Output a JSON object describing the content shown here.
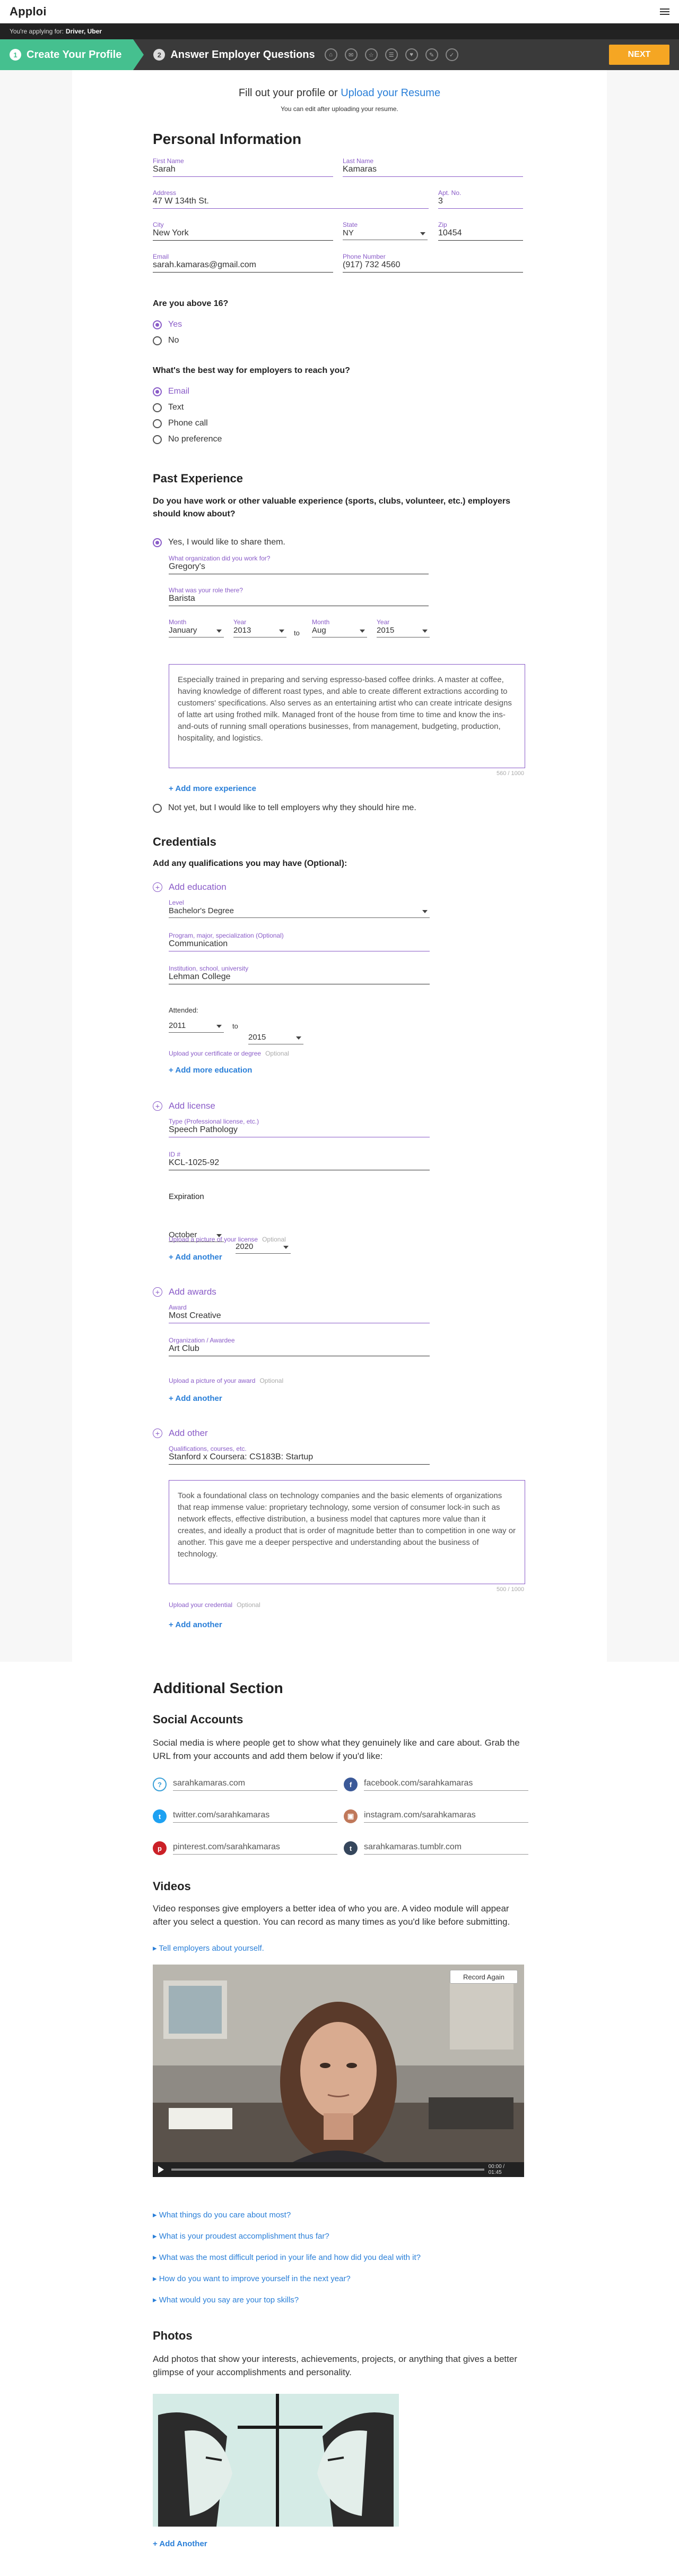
{
  "app": {
    "logo": "Apploi",
    "applying_prefix": "You're applying for:",
    "job": "Driver, Uber"
  },
  "steps": {
    "step1_num": "1",
    "step1": "Create Your Profile",
    "step2_num": "2",
    "step2": "Answer Employer Questions",
    "next": "NEXT",
    "step_icons": [
      "⌂",
      "✉",
      "☆",
      "☰",
      "♥",
      "✎",
      "✓"
    ]
  },
  "intro": {
    "prefix": "Fill out your profile or",
    "link": "Upload your Resume",
    "note": "You can edit after uploading your resume."
  },
  "personal": {
    "title": "Personal Information",
    "first_label": "First Name",
    "first": "Sarah",
    "last_label": "Last Name",
    "last": "Kamaras",
    "address_label": "Address",
    "address": "47 W 134th St.",
    "apt_label": "Apt. No.",
    "apt": "3",
    "city_label": "City",
    "city": "New York",
    "state_label": "State",
    "state": "NY",
    "zip_label": "Zip",
    "zip": "10454",
    "email_label": "Email",
    "email": "sarah.kamaras@gmail.com",
    "phone_label": "Phone Number",
    "phone": "(917) 732 4560",
    "age_q": "Are you above 16?",
    "age_yes": "Yes",
    "age_no": "No",
    "reach_q": "What's the best way for employers to reach you?",
    "reach_opts": [
      "Email",
      "Text",
      "Phone call",
      "No preference"
    ]
  },
  "past": {
    "title": "Past Experience",
    "q": "Do you have work or other valuable experience (sports, clubs, volunteer, etc.) employers should know about?",
    "yes": "Yes, I would like to share them.",
    "org_label": "What organization did you work for?",
    "org": "Gregory's",
    "role_label": "What was your role there?",
    "role": "Barista",
    "month_label": "Month",
    "year_label": "Year",
    "start_month": "January",
    "start_year": "2013",
    "to": "to",
    "end_month": "Aug",
    "end_year": "2015",
    "desc": "Especially trained in preparing and serving espresso-based coffee drinks. A master at coffee, having knowledge of different roast types, and able to create different extractions according to customers' specifications. Also serves as an entertaining artist who can create intricate designs of latte art using frothed milk. Managed front of the house from time to time and know the ins-and-outs of running small operations businesses, from management, budgeting, production, hospitality, and logistics.",
    "counter": "560 / 1000",
    "add_more": "+ Add more experience",
    "not_yet": "Not yet, but I would like to tell employers why they should hire me."
  },
  "credentials": {
    "title": "Credentials",
    "q": "Add any qualifications you may have (Optional):",
    "edu_add": "Add education",
    "level_label": "Level",
    "level": "Bachelor's Degree",
    "program_label": "Program, major, specialization (Optional)",
    "program": "Communication",
    "inst_label": "Institution, school, university",
    "inst": "Lehman College",
    "attended": "Attended:",
    "att_from": "2011",
    "att_to": "to",
    "att_end": "2015",
    "edu_upload": "Upload your certificate or degree",
    "optional": "Optional",
    "edu_more": "+ Add more education",
    "lic_add": "Add license",
    "lic_type_label": "Type (Professional license, etc.)",
    "lic_type": "Speech Pathology",
    "lic_id_label": "ID #",
    "lic_id": "KCL-1025-92",
    "expiration": "Expiration",
    "exp_month": "October",
    "exp_year": "2020",
    "lic_upload": "Upload a picture of your license",
    "lic_more": "+ Add another",
    "award_add": "Add awards",
    "award_label": "Award",
    "award": "Most Creative",
    "awarder_label": "Organization / Awardee",
    "awarder": "Art Club",
    "award_upload": "Upload a picture of your award",
    "award_more": "+ Add another",
    "other_add": "Add other",
    "other_label": "Qualifications, courses, etc.",
    "other": "Stanford x Coursera: CS183B: Startup",
    "other_desc": "Took a foundational class on technology companies and the basic elements of organizations that reap immense value: proprietary technology, some version of consumer lock-in such as network effects, effective distribution, a business model that captures more value than it creates, and ideally a product that is order of magnitude better than to competition in one way or another. This gave me a deeper perspective and understanding about the business of technology.",
    "other_counter": "500 / 1000",
    "other_upload": "Upload your credential",
    "other_more": "+ Add another"
  },
  "additional": {
    "title": "Additional Section",
    "social_title": "Social Accounts",
    "social_desc": "Social media is where people get to show what they genuinely like and care about. Grab the URL from your accounts and add them below if you'd like:",
    "social": [
      {
        "icon": "website-icon",
        "val": "sarahkamaras.com",
        "color": "#3aa0d8",
        "glyph": "?"
      },
      {
        "icon": "facebook-icon",
        "val": "facebook.com/sarahkamaras",
        "color": "#3b5998",
        "glyph": "f"
      },
      {
        "icon": "twitter-icon",
        "val": "twitter.com/sarahkamaras",
        "color": "#1da1f2",
        "glyph": "t"
      },
      {
        "icon": "instagram-icon",
        "val": "instagram.com/sarahkamaras",
        "color": "#c0785a",
        "glyph": "▣"
      },
      {
        "icon": "pinterest-icon",
        "val": "pinterest.com/sarahkamaras",
        "color": "#cb2027",
        "glyph": "p"
      },
      {
        "icon": "tumblr-icon",
        "val": "sarahkamaras.tumblr.com",
        "color": "#35465c",
        "glyph": "t"
      }
    ],
    "videos_title": "Videos",
    "videos_desc": "Video responses give employers a better idea of who you are. A video module will appear after you select a question. You can record as many times as you'd like before submitting.",
    "video_q": "▸ Tell employers about yourself.",
    "record_again": "Record Again",
    "video_time": "00:00 / 01:45",
    "questions": [
      "▸ What things do you care about most?",
      "▸ What is your proudest accomplishment thus far?",
      "▸ What was the most difficult period in your life and how did you deal with it?",
      "▸ How do you want to improve yourself in the next year?",
      "▸ What would you say are your top skills?"
    ],
    "photos_title": "Photos",
    "photos_desc": "Add photos that show your interests, achievements, projects, or anything that gives a better glimpse of your accomplishments and personality.",
    "add_another": "+ Add Another"
  }
}
